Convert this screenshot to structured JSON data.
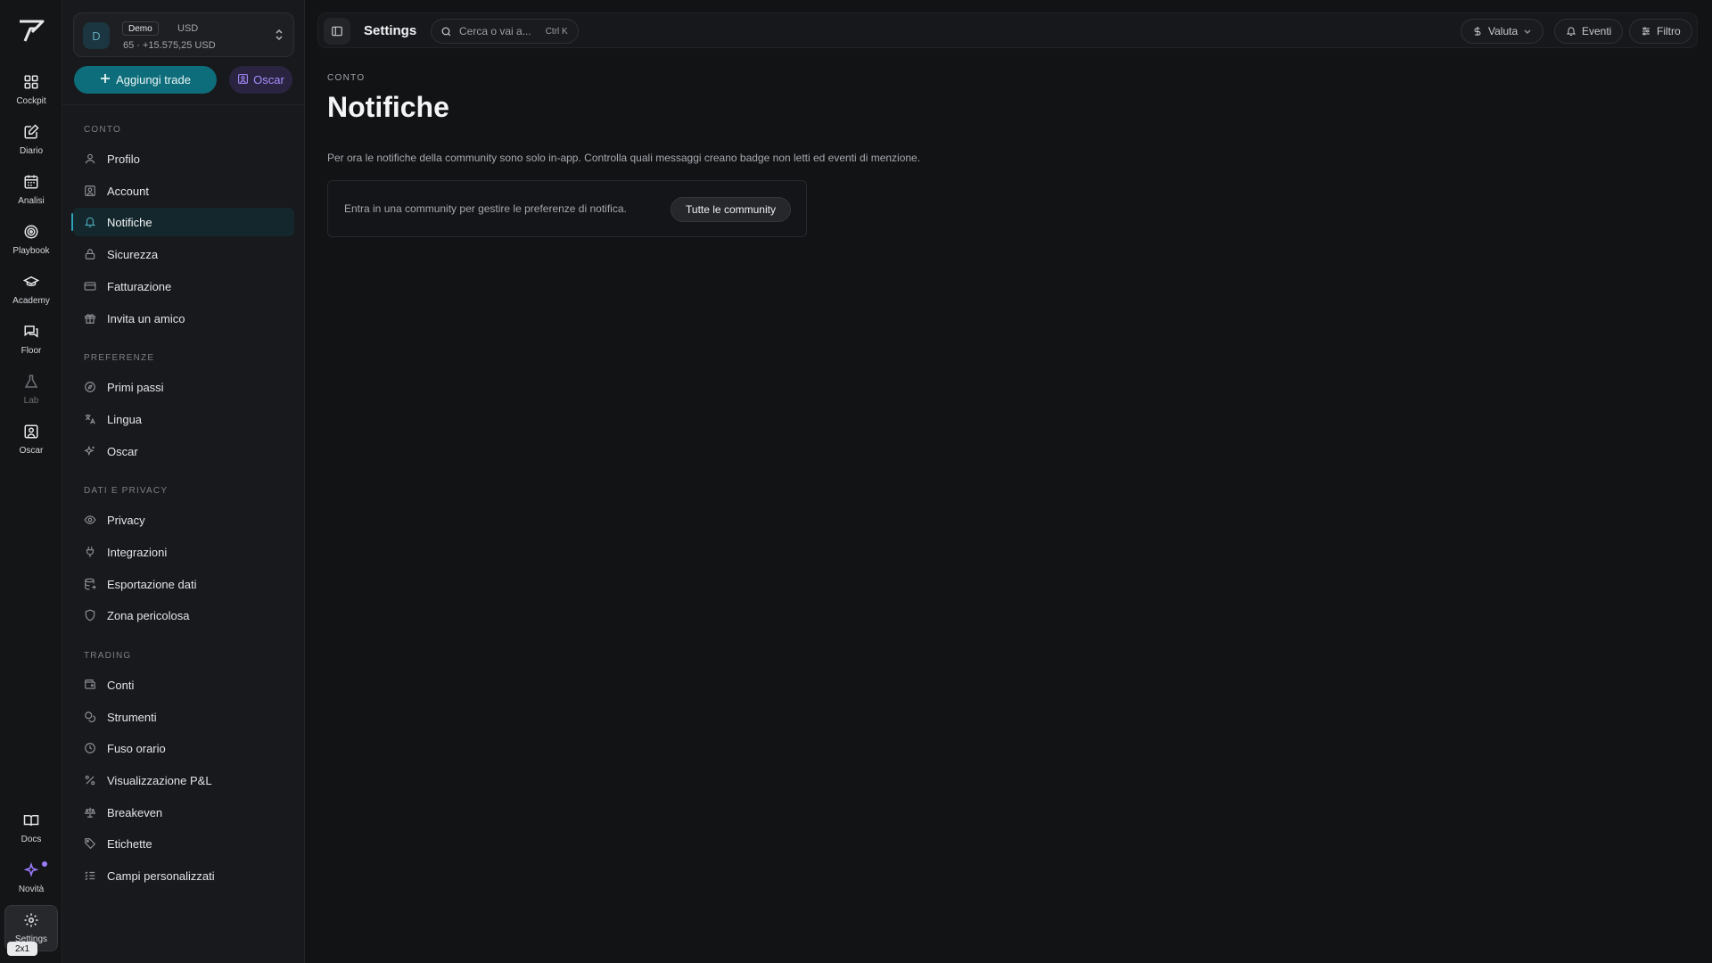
{
  "rail": {
    "items": [
      {
        "label": "Cockpit"
      },
      {
        "label": "Diario"
      },
      {
        "label": "Analisi"
      },
      {
        "label": "Playbook"
      },
      {
        "label": "Academy"
      },
      {
        "label": "Floor"
      },
      {
        "label": "Lab"
      },
      {
        "label": "Oscar"
      }
    ],
    "bottom": [
      {
        "label": "Docs"
      },
      {
        "label": "Novità"
      },
      {
        "label": "Settings"
      }
    ],
    "zoom_badge": "2x1"
  },
  "account": {
    "avatar": "D",
    "badge": "Demo",
    "currency": "USD",
    "summary": "65 · +15.575,25 USD"
  },
  "actions": {
    "add_trade": "Aggiungi trade",
    "oscar": "Oscar"
  },
  "sidebar": {
    "sections": [
      {
        "title": "CONTO",
        "items": [
          "Profilo",
          "Account",
          "Notifiche",
          "Sicurezza",
          "Fatturazione",
          "Invita un amico"
        ]
      },
      {
        "title": "PREFERENZE",
        "items": [
          "Primi passi",
          "Lingua",
          "Oscar"
        ]
      },
      {
        "title": "DATI E PRIVACY",
        "items": [
          "Privacy",
          "Integrazioni",
          "Esportazione dati",
          "Zona pericolosa"
        ]
      },
      {
        "title": "TRADING",
        "items": [
          "Conti",
          "Strumenti",
          "Fuso orario",
          "Visualizzazione P&L",
          "Breakeven",
          "Etichette",
          "Campi personalizzati"
        ]
      }
    ],
    "active": "Notifiche"
  },
  "topbar": {
    "title": "Settings",
    "search_placeholder": "Cerca o vai a...",
    "search_shortcut": "Ctrl K",
    "currency_btn": "Valuta",
    "events_btn": "Eventi",
    "filter_btn": "Filtro"
  },
  "main": {
    "breadcrumb": "CONTO",
    "title": "Notifiche",
    "description": "Per ora le notifiche della community sono solo in-app. Controlla quali messaggi creano badge non letti ed eventi di menzione.",
    "card_text": "Entra in una community per gestire le preferenze di notifica.",
    "card_button": "Tutte le community"
  },
  "colors": {
    "accent": "#0e6d7a",
    "oscar": "#a88cff",
    "background": "#121315"
  }
}
